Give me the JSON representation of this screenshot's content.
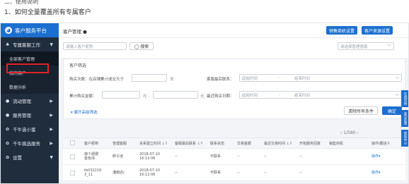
{
  "doc": {
    "section_heading": "二、使用说明",
    "sub_heading": "1、如何全量覆盖所有专属客户"
  },
  "brand": {
    "logo_glyph": "◕",
    "name": "客户服务平台"
  },
  "sidebar": {
    "items": [
      {
        "icon": "♣",
        "label": "专属客服工作",
        "caret": "▼"
      },
      {
        "label": "全部客户管理",
        "active": true
      },
      {
        "label": "我的客户"
      },
      {
        "label": "数据分析"
      },
      {
        "icon": "●",
        "label": "流动管理",
        "caret": "▶"
      },
      {
        "icon": "●",
        "label": "服务管理",
        "caret": "▶"
      },
      {
        "icon": "✿",
        "label": "千牛选小蜜",
        "caret": "▶"
      },
      {
        "icon": "✿",
        "label": "千牛挑选服务",
        "caret": "▶"
      },
      {
        "icon": "✿",
        "label": "设置",
        "caret": "▼"
      }
    ]
  },
  "topbar": {
    "title": "客户管理 ●",
    "btn_sales_settings": "销售商机设置",
    "btn_source_settings": "客户来源设置"
  },
  "search": {
    "placeholder": "请输入客户昵称",
    "search_button": "◯ 搜索",
    "group_select_placeholder": "请选择管理客服",
    "group_select_caret": "﹀"
  },
  "filter": {
    "panel_title": "客户筛选",
    "purchase_count_label": "购买次数：在店铺累计成交大于",
    "purchase_count_unit": "次",
    "last_contact_label": "客服最后联系：",
    "last_contact_start": "起始时间",
    "last_contact_sep": "-",
    "last_contact_end": "结束时间",
    "total_amount_label": "累计购买金额：",
    "total_amount_unit1": "元 -",
    "total_amount_unit2": "元",
    "last_purchase_label": "最近购买日期：",
    "last_purchase_start": "起始时间",
    "last_purchase_sep": "-",
    "last_purchase_end": "结束时间",
    "calendar_icon": "▭",
    "expand_link": "▾  展开高级筛选",
    "clear_button": "清除所有条件",
    "confirm_button": "确定"
  },
  "pager": {
    "text": "‹  1/580  ›"
  },
  "table": {
    "headers": [
      "客户昵称",
      "管理客服",
      "关系建立时间 ↓↑",
      "客服最后联系 ↓↑",
      "联系状态",
      "交易金额",
      "最近交易时间 ↓↑",
      "开拓服务回复",
      "销售商机",
      "操作/跟进人"
    ],
    "rows": [
      {
        "nick": "旗个绸裙\n金色浑",
        "agent": "胖子迷",
        "created": "2018-07-10\n16:12:06",
        "last_contact": "--",
        "status": "可联系",
        "amount": "--",
        "last_trade": "--",
        "reply": "--",
        "op": "操作▾"
      },
      {
        "nick": "tb032219\n3_11",
        "agent": "潘施店/",
        "created": "2018-07-10\n16:12:06",
        "last_contact": "--",
        "status": "可联系",
        "amount": "--",
        "last_trade": "--",
        "reply": "--",
        "op": "操作▾"
      }
    ]
  },
  "right_tabs": [
    "在线咨询",
    "意见反馈",
    "帮助中心"
  ],
  "colors": {
    "primary": "#1b6fd0",
    "sidebar_bg": "#1f2d3d",
    "highlight_border": "#e0222a"
  }
}
